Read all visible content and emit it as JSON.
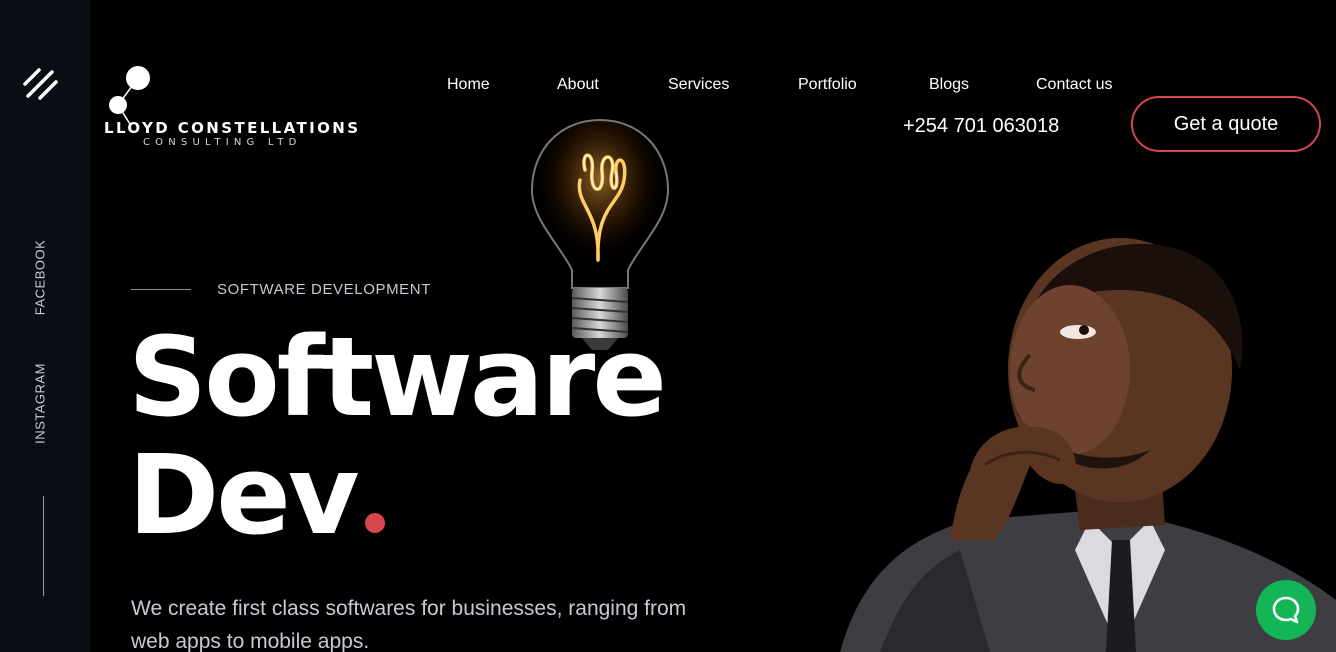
{
  "brand": {
    "name": "LLOYD CONSTELLATIONS",
    "sub": "CONSULTING LTD"
  },
  "nav": {
    "items": [
      "Home",
      "About",
      "Services",
      "Portfolio",
      "Blogs",
      "Contact us"
    ]
  },
  "header": {
    "phone": "+254 701 063018",
    "cta_label": "Get a quote"
  },
  "sidebar": {
    "social": [
      "FACEBOOK",
      "INSTAGRAM"
    ]
  },
  "hero": {
    "eyebrow": "SOFTWARE DEVELOPMENT",
    "title_line1": "Software",
    "title_line2": "Dev",
    "description": "We create first class softwares for businesses, ranging from web apps to mobile apps."
  },
  "colors": {
    "accent": "#d6464a",
    "chat": "#13b556",
    "rail": "#0a0d14"
  },
  "icons": {
    "menu": "menu-icon",
    "chat": "chat-icon",
    "bulb": "lightbulb-icon"
  }
}
